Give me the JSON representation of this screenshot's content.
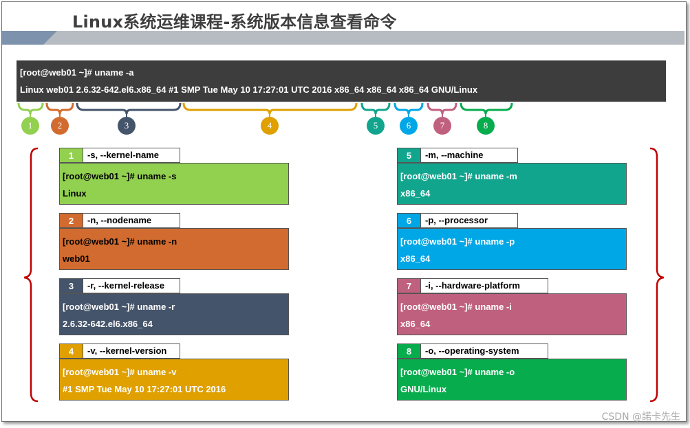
{
  "title": "Linux系统运维课程-系统版本信息查看命令",
  "terminal": {
    "command": "[root@web01 ~]# uname -a",
    "output": "Linux web01 2.6.32-642.el6.x86_64 #1 SMP Tue May 10 17:27:01 UTC 2016 x86_64 x86_64 x86_64 GNU/Linux"
  },
  "markers": [
    {
      "label": "1",
      "color": "#92d050"
    },
    {
      "label": "2",
      "color": "#d26b2f"
    },
    {
      "label": "3",
      "color": "#44546a"
    },
    {
      "label": "4",
      "color": "#dfa000"
    },
    {
      "label": "5",
      "color": "#12a58e"
    },
    {
      "label": "6",
      "color": "#00a7e6"
    },
    {
      "label": "7",
      "color": "#c0607f"
    },
    {
      "label": "8",
      "color": "#07ac4d"
    }
  ],
  "cards": [
    {
      "num": "1",
      "option": "-s, --kernel-name",
      "command": "[root@web01 ~]# uname -s",
      "output": "Linux",
      "color": "#92d050",
      "text_color": "#000000"
    },
    {
      "num": "2",
      "option": "-n, --nodename",
      "command": "[root@web01 ~]# uname -n",
      "output": "web01",
      "color": "#d26b2f",
      "text_color": "#000000"
    },
    {
      "num": "3",
      "option": "-r, --kernel-release",
      "command": "[root@web01 ~]# uname -r",
      "output": "2.6.32-642.el6.x86_64",
      "color": "#44546a",
      "text_color": "#ffffff"
    },
    {
      "num": "4",
      "option": "-v, --kernel-version",
      "command": "[root@web01 ~]# uname -v",
      "output": "#1 SMP Tue May 10 17:27:01 UTC 2016",
      "color": "#dfa000",
      "text_color": "#ffffff"
    },
    {
      "num": "5",
      "option": "-m, --machine",
      "command": "[root@web01 ~]# uname -m",
      "output": "x86_64",
      "color": "#12a58e",
      "text_color": "#ffffff"
    },
    {
      "num": "6",
      "option": "-p, --processor",
      "command": "[root@web01 ~]# uname -p",
      "output": "x86_64",
      "color": "#00a7e6",
      "text_color": "#ffffff"
    },
    {
      "num": "7",
      "option": "-i, --hardware-platform",
      "command": "[root@web01 ~]# uname -i",
      "output": "x86_64",
      "color": "#c0607f",
      "text_color": "#ffffff"
    },
    {
      "num": "8",
      "option": "-o, --operating-system",
      "command": "[root@web01 ~]# uname -o",
      "output": "GNU/Linux",
      "color": "#07ac4d",
      "text_color": "#ffffff"
    }
  ],
  "brace_color": "#c00000",
  "watermark": "CSDN @諾卡先生"
}
